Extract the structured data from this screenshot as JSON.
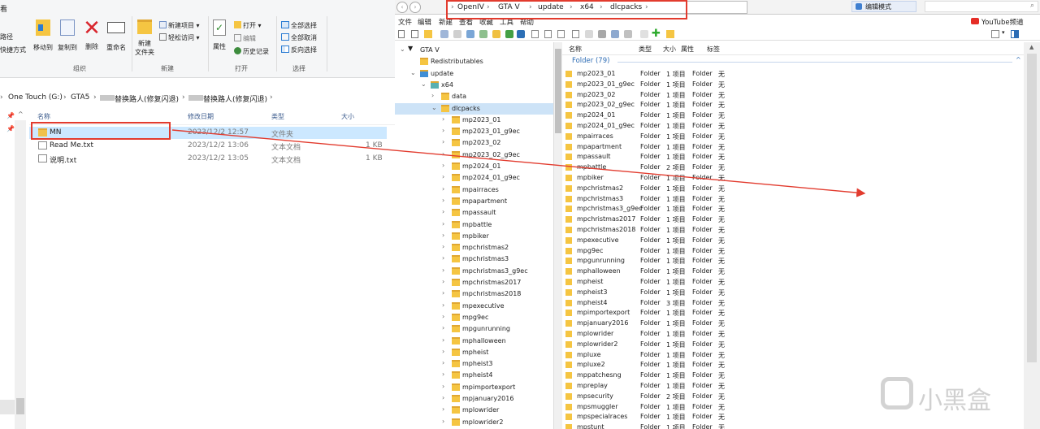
{
  "explorer": {
    "ribbon": {
      "partial_top": "看",
      "partial_left_1": "路径",
      "partial_left_2": "快捷方式",
      "move_to": "移动到",
      "copy_to": "复制到",
      "delete": "删除",
      "rename": "重命名",
      "new_folder_1": "新建",
      "new_folder_2": "文件夹",
      "new_item": "新建项目 ▾",
      "easy_access": "轻松访问 ▾",
      "properties": "属性",
      "open": "打开 ▾",
      "edit": "编辑",
      "history": "历史记录",
      "select_all": "全部选择",
      "select_none": "全部取消",
      "invert_selection": "反向选择",
      "group_organize": "组织",
      "group_new": "新建",
      "group_open": "打开",
      "group_select": "选择"
    },
    "breadcrumb": [
      "One Touch (G:)",
      "GTA5",
      "替换路人(修复闪退)",
      "替换路人(修复闪退)"
    ],
    "columns": {
      "name": "名称",
      "modified": "修改日期",
      "type": "类型",
      "size": "大小"
    },
    "files": [
      {
        "name": "MN",
        "modified": "2023/12/2 12:57",
        "type": "文件夹",
        "size": ""
      },
      {
        "name": "Read Me.txt",
        "modified": "2023/12/2 13:06",
        "type": "文本文档",
        "size": "1 KB"
      },
      {
        "name": "说明.txt",
        "modified": "2023/12/2 13:05",
        "type": "文本文档",
        "size": "1 KB"
      }
    ]
  },
  "openiv": {
    "address": [
      "OpenIV",
      "GTA V",
      "update",
      "x64",
      "dlcpacks"
    ],
    "edit_mode": "编辑模式",
    "youtube": "YouTube频道",
    "menu": [
      "文件",
      "编辑",
      "新建",
      "查看",
      "收藏",
      "工具",
      "帮助"
    ],
    "tree_root": "GTA V",
    "tree_top": [
      {
        "label": "Redistributables",
        "level": 1,
        "expander": ""
      },
      {
        "label": "update",
        "level": 1,
        "expander": "v"
      },
      {
        "label": "x64",
        "level": 2,
        "expander": "v"
      },
      {
        "label": "data",
        "level": 3,
        "expander": ">"
      },
      {
        "label": "dlcpacks",
        "level": 3,
        "expander": "v"
      }
    ],
    "list_header": {
      "name": "名称",
      "type": "类型",
      "size": "大小",
      "attr": "属性",
      "tag": "标签"
    },
    "group_label": "Folder (79)",
    "folders": [
      "mp2023_01",
      "mp2023_01_g9ec",
      "mp2023_02",
      "mp2023_02_g9ec",
      "mp2024_01",
      "mp2024_01_g9ec",
      "mpairraces",
      "mpapartment",
      "mpassault",
      "mpbattle",
      "mpbiker",
      "mpchristmas2",
      "mpchristmas3",
      "mpchristmas3_g9ec",
      "mpchristmas2017",
      "mpchristmas2018",
      "mpexecutive",
      "mpg9ec",
      "mpgunrunning",
      "mphalloween",
      "mpheist",
      "mpheist3",
      "mpheist4",
      "mpimportexport",
      "mpjanuary2016",
      "mplowrider",
      "mplowrider2",
      "mpluxe",
      "mpluxe2",
      "mppatchesng",
      "mpreplay",
      "mpsecurity",
      "mpsmuggler",
      "mpspecialraces",
      "mpstunt"
    ],
    "item_counts": [
      "1 项目",
      "1 项目",
      "1 项目",
      "1 项目",
      "1 项目",
      "1 项目",
      "1 项目",
      "1 项目",
      "1 项目",
      "2 项目",
      "1 项目",
      "1 项目",
      "1 项目",
      "1 项目",
      "1 项目",
      "1 项目",
      "1 项目",
      "1 项目",
      "1 项目",
      "1 项目",
      "1 项目",
      "1 项目",
      "3 项目",
      "1 项目",
      "1 项目",
      "1 项目",
      "1 项目",
      "1 项目",
      "1 项目",
      "1 项目",
      "1 项目",
      "2 项目",
      "1 项目",
      "1 项目",
      "1 项目"
    ],
    "folder_type": "Folder",
    "folder_attr": "Folder",
    "folder_tag": "无"
  },
  "watermark": "小黑盒",
  "colors": {
    "annotation_red": "#e23b2e",
    "selection_blue": "#cce8ff",
    "folder_yellow": "#f5c542"
  }
}
